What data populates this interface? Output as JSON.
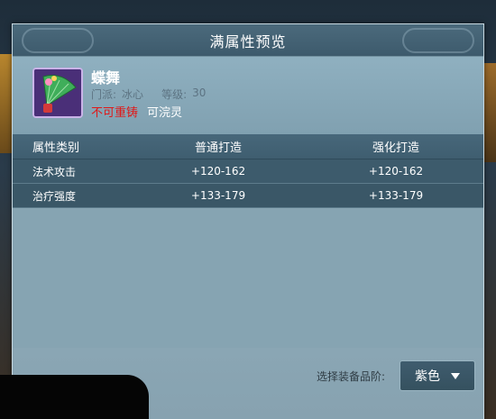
{
  "dialog": {
    "title": "满属性预览"
  },
  "item": {
    "name": "蝶舞",
    "sect_label": "门派:",
    "sect_value": "冰心",
    "level_label": "等级:",
    "level_value": "30",
    "tag_no_recast": "不可重铸",
    "tag_can_refine": "可浣灵",
    "icon": "fan-icon",
    "icon_bg_color": "#5b3c8a"
  },
  "table": {
    "headers": [
      "属性类别",
      "普通打造",
      "强化打造"
    ],
    "rows": [
      [
        "法术攻击",
        "+120-162",
        "+120-162"
      ],
      [
        "治疗强度",
        "+133-179",
        "+133-179"
      ]
    ]
  },
  "footer": {
    "quality_label": "选择装备品阶:",
    "quality_value": "紫色"
  },
  "colors": {
    "tag_red": "#e01818",
    "panel_bg": "#8aa6b4",
    "header_bar": "#47677a"
  }
}
